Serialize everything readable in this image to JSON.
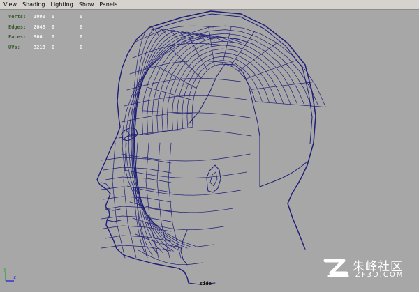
{
  "menubar": {
    "items": [
      "View",
      "Shading",
      "Lighting",
      "Show",
      "Panels"
    ]
  },
  "hud": {
    "rows": [
      {
        "label": "Verts:",
        "v1": "1090",
        "v2": "0",
        "v3": "0"
      },
      {
        "label": "Edges:",
        "v1": "2048",
        "v2": "0",
        "v3": "0"
      },
      {
        "label": "Faces:",
        "v1": "966",
        "v2": "0",
        "v3": "0"
      },
      {
        "label": "UVs:",
        "v1": "3218",
        "v2": "0",
        "v3": "0"
      }
    ]
  },
  "viewport": {
    "camera_label": "side",
    "background": "#a7a7a7",
    "wire_color": "#1e1e78"
  },
  "axis": {
    "y": "y",
    "z": "z",
    "y_color": "#2fa52f",
    "z_color": "#2f2fd0"
  },
  "watermark": {
    "brand_cn": "朱峰社区",
    "brand_en": "ZF3D.COM"
  }
}
